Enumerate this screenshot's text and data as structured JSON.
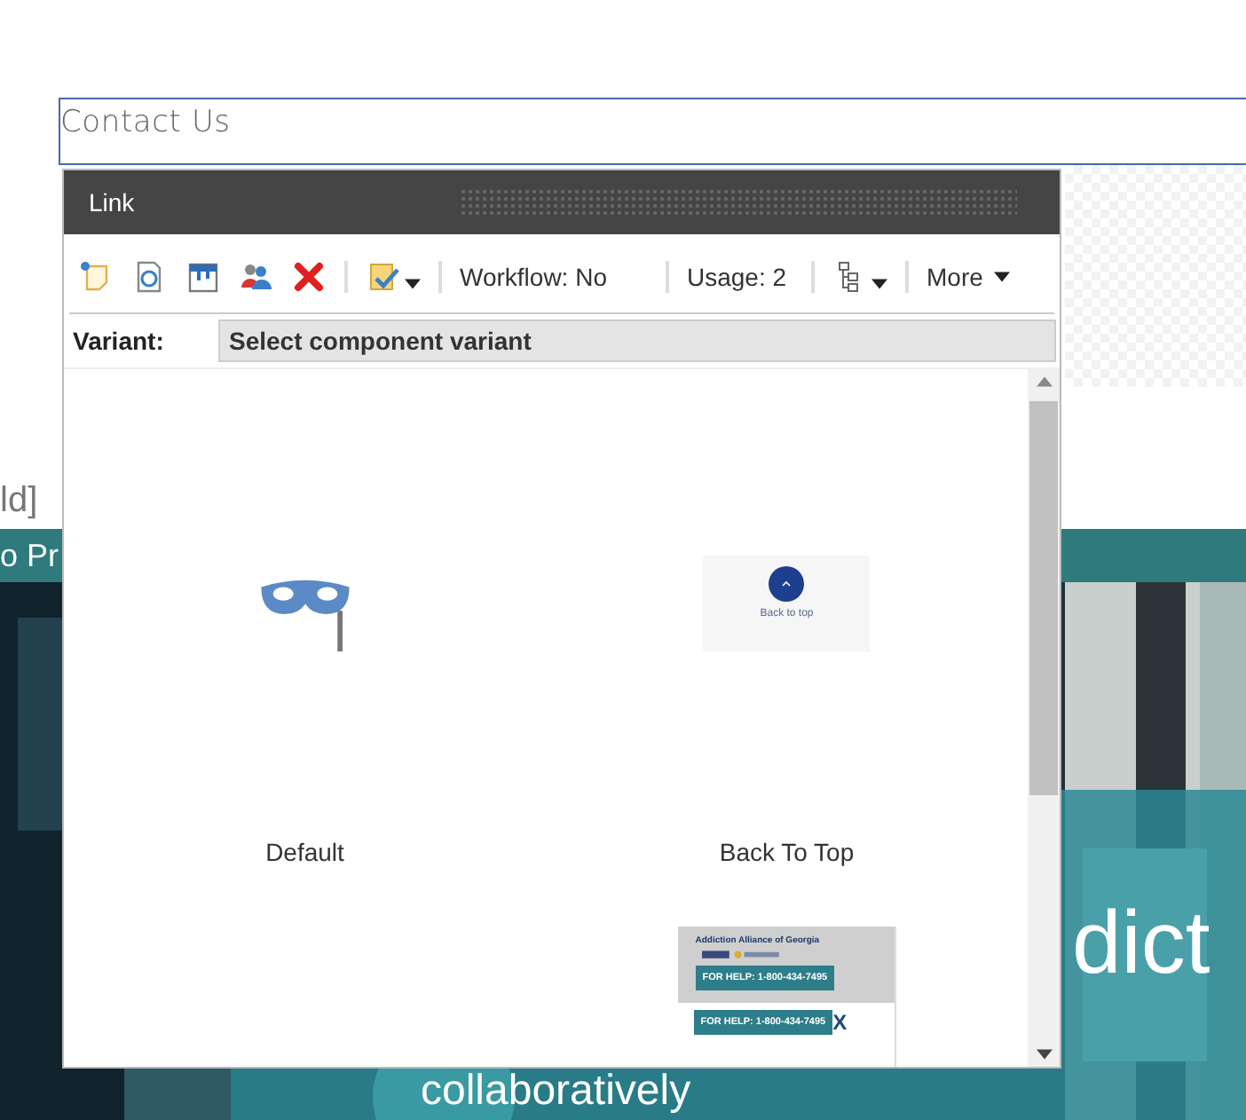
{
  "page": {
    "contact_field": "Contact Us",
    "fragment_text": "ld]",
    "banner_text": "o Pr",
    "headline_1": "dict",
    "headline_2": "collaboratively"
  },
  "dialog": {
    "title": "Link",
    "toolbar": {
      "workflow": "Workflow: No",
      "usage": "Usage: 2",
      "more": "More"
    },
    "variant": {
      "label": "Variant:",
      "placeholder": "Select component variant"
    },
    "variants": [
      {
        "kind": "mask",
        "label": "Default"
      },
      {
        "kind": "back-to-top",
        "label": "Back To Top",
        "preview_text": "Back to top"
      },
      {
        "kind": "banner",
        "heading": "Addiction Alliance of Georgia",
        "help_texts": [
          "FOR HELP: 1-800-434-7495",
          "FOR HELP: 1-800-434-7495"
        ],
        "close": "X"
      }
    ]
  }
}
